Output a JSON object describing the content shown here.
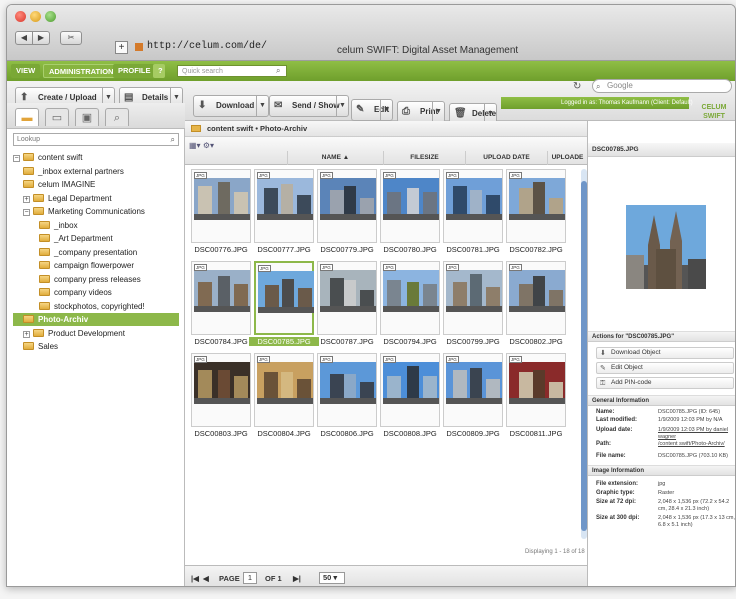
{
  "window": {
    "title": "celum SWIFT: Digital Asset Management",
    "url": "http://celum.com/de/",
    "google_placeholder": "Google"
  },
  "appnav": {
    "tabs": [
      "VIEW",
      "ADMINISTRATION",
      "PROFILE",
      "?"
    ],
    "quicksearch_placeholder": "Quick search",
    "logged_in": "Logged in as: Thomas Kaufmann (Client: Default)",
    "logo_line1": "CELUM",
    "logo_line2": "SWIFT"
  },
  "toolbar": {
    "create": "Create / Upload",
    "details": "Details",
    "download": "Download",
    "send": "Send / Show",
    "edit": "Edit",
    "print": "Print",
    "delete": "Delete"
  },
  "left": {
    "lookup_placeholder": "Lookup",
    "tree": [
      {
        "label": "content swift",
        "level": 0,
        "expander": "−"
      },
      {
        "label": "_inbox external partners",
        "level": 1
      },
      {
        "label": "celum IMAGINE",
        "level": 1
      },
      {
        "label": "Legal Department",
        "level": 1,
        "expander": "+"
      },
      {
        "label": "Marketing Communications",
        "level": 1,
        "expander": "−"
      },
      {
        "label": "_inbox",
        "level": 2
      },
      {
        "label": "_Art Department",
        "level": 2
      },
      {
        "label": "_company presentation",
        "level": 2
      },
      {
        "label": "campaign flowerpower",
        "level": 2
      },
      {
        "label": "company press releases",
        "level": 2
      },
      {
        "label": "company videos",
        "level": 2
      },
      {
        "label": "stockphotos, copyrighted!",
        "level": 2
      },
      {
        "label": "Photo-Archiv",
        "level": 1,
        "selected": true
      },
      {
        "label": "Product Development",
        "level": 1,
        "expander": "+"
      },
      {
        "label": "Sales",
        "level": 1
      }
    ]
  },
  "grid": {
    "breadcrumb": "content swift  •  Photo-Archiv",
    "columns": [
      "NAME",
      "FILESIZE",
      "UPLOAD DATE",
      "UPLOADE"
    ],
    "badge": "JPG",
    "thumbs": [
      "DSC00776.JPG",
      "DSC00777.JPG",
      "DSC00779.JPG",
      "DSC00780.JPG",
      "DSC00781.JPG",
      "DSC00782.JPG",
      "DSC00784.JPG",
      "DSC00785.JPG",
      "DSC00787.JPG",
      "DSC00794.JPG",
      "DSC00799.JPG",
      "DSC00802.JPG",
      "DSC00803.JPG",
      "DSC00804.JPG",
      "DSC00806.JPG",
      "DSC00808.JPG",
      "DSC00809.JPG",
      "DSC00811.JPG"
    ],
    "selected_index": 7,
    "displaying": "Displaying 1 - 18 of 18",
    "pager": {
      "page_label": "PAGE",
      "page": "1",
      "of_label": "OF 1",
      "size": "50"
    }
  },
  "details": {
    "filename": "DSC00785.JPG",
    "actions_title": "Actions for \"DSC00785.JPG\"",
    "actions": [
      "Download Object",
      "Edit Object",
      "Add PIN-code"
    ],
    "general_title": "General Information",
    "general": [
      {
        "k": "Name:",
        "v": "DSC00785.JPG (ID: 645)"
      },
      {
        "k": "Last modified:",
        "v": "1/9/2009 12:03 PM by N/A"
      },
      {
        "k": "Upload date:",
        "v": "1/9/2009 12:03 PM by daniel wagner"
      },
      {
        "k": "Path:",
        "v": "/content swift/Photo-Archiv/"
      },
      {
        "k": "File name:",
        "v": "DSC00785.JPG (703.10 KB)"
      }
    ],
    "image_title": "Image Information",
    "image": [
      {
        "k": "File extension:",
        "v": "jpg"
      },
      {
        "k": "Graphic type:",
        "v": "Raster"
      },
      {
        "k": "Size at 72 dpi:",
        "v": "2,048 x 1,536 px (72.2 x 54.2 cm, 28.4 x 21.3 inch)"
      },
      {
        "k": "Size at 300 dpi:",
        "v": "2,048 x 1,536 px (17.3 x 13 cm, 6.8 x 5.1 inch)"
      }
    ]
  }
}
